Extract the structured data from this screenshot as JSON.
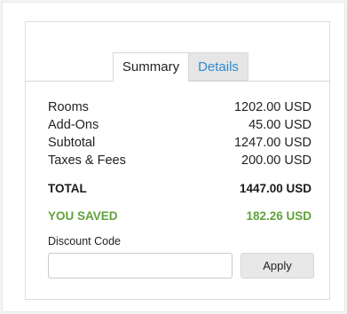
{
  "tabs": [
    {
      "label": "Summary",
      "active": true
    },
    {
      "label": "Details",
      "active": false
    }
  ],
  "summary": {
    "rows": [
      {
        "label": "Rooms",
        "value": "1202.00 USD"
      },
      {
        "label": "Add-Ons",
        "value": "45.00 USD"
      },
      {
        "label": "Subtotal",
        "value": "1247.00 USD"
      },
      {
        "label": "Taxes & Fees",
        "value": "200.00 USD"
      }
    ],
    "total": {
      "label": "TOTAL",
      "value": "1447.00 USD"
    },
    "saved": {
      "label": "YOU SAVED",
      "value": "182.26 USD"
    }
  },
  "discount": {
    "label": "Discount Code",
    "value": "",
    "apply_label": "Apply"
  },
  "colors": {
    "link_blue": "#2b8ad0",
    "saved_green": "#5fa33a"
  }
}
